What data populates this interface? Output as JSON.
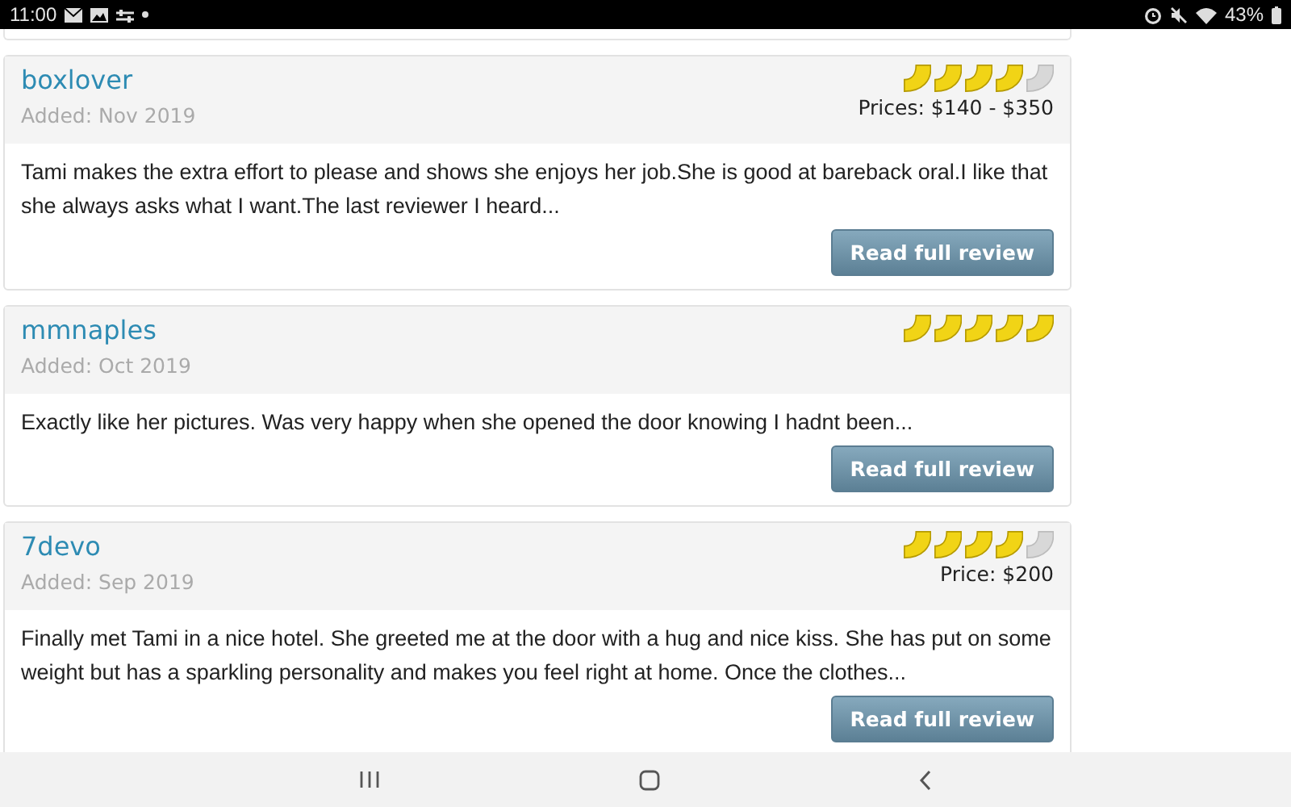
{
  "status_bar": {
    "time": "11:00",
    "battery": "43%"
  },
  "reviews": [
    {
      "author": "boxlover",
      "added": "Added: Nov 2019",
      "stars": 4,
      "price": "Prices: $140 - $350",
      "excerpt": "Tami makes the extra effort to please and shows she enjoys her job.She is good at bareback oral.I like that she always asks what I want.The last reviewer I heard...",
      "button": "Read full review"
    },
    {
      "author": "mmnaples",
      "added": "Added: Oct 2019",
      "stars": 5,
      "excerpt": "Exactly like her pictures. Was very happy when she opened the door knowing I hadnt been...",
      "button": "Read full review"
    },
    {
      "author": "7devo",
      "added": "Added: Sep 2019",
      "stars": 4,
      "price": "Price: $200",
      "excerpt": "Finally met Tami in a nice hotel. She greeted me at the door with a hug and nice kiss. She has put on some weight but has a sparkling personality and makes you feel right at home. Once the clothes...",
      "button": "Read full review"
    }
  ]
}
